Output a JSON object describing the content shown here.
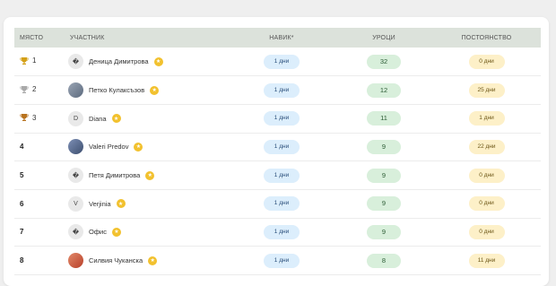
{
  "table": {
    "headers": {
      "place": "МЯСТО",
      "user": "УЧАСТНИК",
      "streak": "НАВИК*",
      "lessons": "УРОЦИ",
      "consistency": "ПОСТОЯНСТВО"
    },
    "rows": [
      {
        "rank": "1",
        "trophy": "gold",
        "avatar": "�",
        "avatar_type": "text",
        "name": "Деница Димитрова",
        "streak": "1 дни",
        "lessons": "32",
        "consistency": "0 дни"
      },
      {
        "rank": "2",
        "trophy": "silver",
        "avatar": "",
        "avatar_type": "photo",
        "name": "Петко Кулаксъзов",
        "streak": "1 дни",
        "lessons": "12",
        "consistency": "25 дни"
      },
      {
        "rank": "3",
        "trophy": "bronze",
        "avatar": "D",
        "avatar_type": "text",
        "name": "Diana",
        "streak": "1 дни",
        "lessons": "11",
        "consistency": "1 дни"
      },
      {
        "rank": "4",
        "trophy": "",
        "avatar": "",
        "avatar_type": "photo2",
        "name": "Valeri Predov",
        "streak": "1 дни",
        "lessons": "9",
        "consistency": "22 дни"
      },
      {
        "rank": "5",
        "trophy": "",
        "avatar": "�",
        "avatar_type": "text",
        "name": "Петя Димитрова",
        "streak": "1 дни",
        "lessons": "9",
        "consistency": "0 дни"
      },
      {
        "rank": "6",
        "trophy": "",
        "avatar": "V",
        "avatar_type": "text",
        "name": "Verjinia",
        "streak": "1 дни",
        "lessons": "9",
        "consistency": "0 дни"
      },
      {
        "rank": "7",
        "trophy": "",
        "avatar": "�",
        "avatar_type": "text",
        "name": "Офис",
        "streak": "1 дни",
        "lessons": "9",
        "consistency": "0 дни"
      },
      {
        "rank": "8",
        "trophy": "",
        "avatar": "",
        "avatar_type": "photo3",
        "name": "Силвия Чуканска",
        "streak": "1 дни",
        "lessons": "8",
        "consistency": "11 дни"
      }
    ]
  },
  "colors": {
    "gold": "#d4a017",
    "silver": "#a9a9a9",
    "bronze": "#b8731f",
    "header_bg": "#dce2db",
    "badge": "#f2c12e"
  }
}
